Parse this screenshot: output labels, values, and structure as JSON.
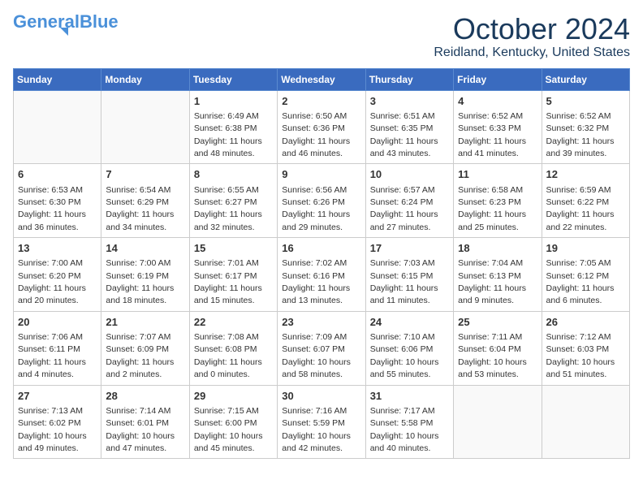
{
  "header": {
    "logo_line1": "General",
    "logo_line2": "Blue",
    "month": "October 2024",
    "location": "Reidland, Kentucky, United States"
  },
  "weekdays": [
    "Sunday",
    "Monday",
    "Tuesday",
    "Wednesday",
    "Thursday",
    "Friday",
    "Saturday"
  ],
  "weeks": [
    [
      {
        "day": "",
        "info": ""
      },
      {
        "day": "",
        "info": ""
      },
      {
        "day": "1",
        "info": "Sunrise: 6:49 AM\nSunset: 6:38 PM\nDaylight: 11 hours and 48 minutes."
      },
      {
        "day": "2",
        "info": "Sunrise: 6:50 AM\nSunset: 6:36 PM\nDaylight: 11 hours and 46 minutes."
      },
      {
        "day": "3",
        "info": "Sunrise: 6:51 AM\nSunset: 6:35 PM\nDaylight: 11 hours and 43 minutes."
      },
      {
        "day": "4",
        "info": "Sunrise: 6:52 AM\nSunset: 6:33 PM\nDaylight: 11 hours and 41 minutes."
      },
      {
        "day": "5",
        "info": "Sunrise: 6:52 AM\nSunset: 6:32 PM\nDaylight: 11 hours and 39 minutes."
      }
    ],
    [
      {
        "day": "6",
        "info": "Sunrise: 6:53 AM\nSunset: 6:30 PM\nDaylight: 11 hours and 36 minutes."
      },
      {
        "day": "7",
        "info": "Sunrise: 6:54 AM\nSunset: 6:29 PM\nDaylight: 11 hours and 34 minutes."
      },
      {
        "day": "8",
        "info": "Sunrise: 6:55 AM\nSunset: 6:27 PM\nDaylight: 11 hours and 32 minutes."
      },
      {
        "day": "9",
        "info": "Sunrise: 6:56 AM\nSunset: 6:26 PM\nDaylight: 11 hours and 29 minutes."
      },
      {
        "day": "10",
        "info": "Sunrise: 6:57 AM\nSunset: 6:24 PM\nDaylight: 11 hours and 27 minutes."
      },
      {
        "day": "11",
        "info": "Sunrise: 6:58 AM\nSunset: 6:23 PM\nDaylight: 11 hours and 25 minutes."
      },
      {
        "day": "12",
        "info": "Sunrise: 6:59 AM\nSunset: 6:22 PM\nDaylight: 11 hours and 22 minutes."
      }
    ],
    [
      {
        "day": "13",
        "info": "Sunrise: 7:00 AM\nSunset: 6:20 PM\nDaylight: 11 hours and 20 minutes."
      },
      {
        "day": "14",
        "info": "Sunrise: 7:00 AM\nSunset: 6:19 PM\nDaylight: 11 hours and 18 minutes."
      },
      {
        "day": "15",
        "info": "Sunrise: 7:01 AM\nSunset: 6:17 PM\nDaylight: 11 hours and 15 minutes."
      },
      {
        "day": "16",
        "info": "Sunrise: 7:02 AM\nSunset: 6:16 PM\nDaylight: 11 hours and 13 minutes."
      },
      {
        "day": "17",
        "info": "Sunrise: 7:03 AM\nSunset: 6:15 PM\nDaylight: 11 hours and 11 minutes."
      },
      {
        "day": "18",
        "info": "Sunrise: 7:04 AM\nSunset: 6:13 PM\nDaylight: 11 hours and 9 minutes."
      },
      {
        "day": "19",
        "info": "Sunrise: 7:05 AM\nSunset: 6:12 PM\nDaylight: 11 hours and 6 minutes."
      }
    ],
    [
      {
        "day": "20",
        "info": "Sunrise: 7:06 AM\nSunset: 6:11 PM\nDaylight: 11 hours and 4 minutes."
      },
      {
        "day": "21",
        "info": "Sunrise: 7:07 AM\nSunset: 6:09 PM\nDaylight: 11 hours and 2 minutes."
      },
      {
        "day": "22",
        "info": "Sunrise: 7:08 AM\nSunset: 6:08 PM\nDaylight: 11 hours and 0 minutes."
      },
      {
        "day": "23",
        "info": "Sunrise: 7:09 AM\nSunset: 6:07 PM\nDaylight: 10 hours and 58 minutes."
      },
      {
        "day": "24",
        "info": "Sunrise: 7:10 AM\nSunset: 6:06 PM\nDaylight: 10 hours and 55 minutes."
      },
      {
        "day": "25",
        "info": "Sunrise: 7:11 AM\nSunset: 6:04 PM\nDaylight: 10 hours and 53 minutes."
      },
      {
        "day": "26",
        "info": "Sunrise: 7:12 AM\nSunset: 6:03 PM\nDaylight: 10 hours and 51 minutes."
      }
    ],
    [
      {
        "day": "27",
        "info": "Sunrise: 7:13 AM\nSunset: 6:02 PM\nDaylight: 10 hours and 49 minutes."
      },
      {
        "day": "28",
        "info": "Sunrise: 7:14 AM\nSunset: 6:01 PM\nDaylight: 10 hours and 47 minutes."
      },
      {
        "day": "29",
        "info": "Sunrise: 7:15 AM\nSunset: 6:00 PM\nDaylight: 10 hours and 45 minutes."
      },
      {
        "day": "30",
        "info": "Sunrise: 7:16 AM\nSunset: 5:59 PM\nDaylight: 10 hours and 42 minutes."
      },
      {
        "day": "31",
        "info": "Sunrise: 7:17 AM\nSunset: 5:58 PM\nDaylight: 10 hours and 40 minutes."
      },
      {
        "day": "",
        "info": ""
      },
      {
        "day": "",
        "info": ""
      }
    ]
  ]
}
